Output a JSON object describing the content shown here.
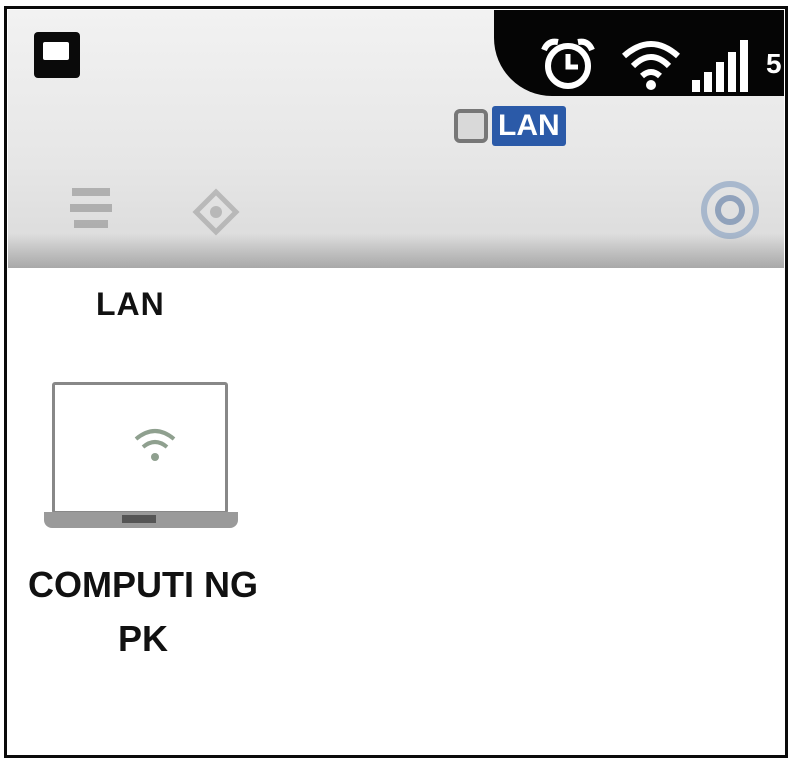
{
  "status_bar": {
    "time": "5:",
    "icons": [
      "notification-icon",
      "alarm-icon",
      "wifi-icon",
      "signal-icon"
    ]
  },
  "header": {
    "network_chip": "LAN",
    "tool_icons": [
      "stack-icon",
      "puzzle-icon",
      "settings-ring-icon"
    ]
  },
  "section": {
    "label": "LAN"
  },
  "devices": [
    {
      "name": "COMPUTI NGPK",
      "icon": "laptop-wifi-icon"
    }
  ],
  "colors": {
    "status_bar": "#050505",
    "chip": "#2b5aa8",
    "header_bg": "#e6e6e6"
  }
}
